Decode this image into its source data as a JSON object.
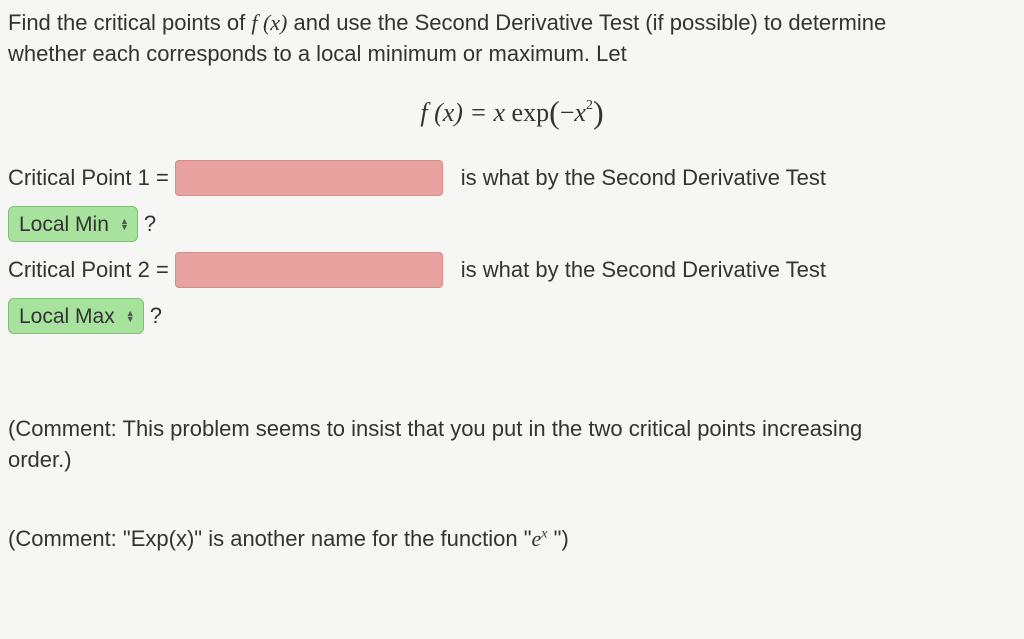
{
  "prompt": {
    "line1_pre": "Find the critical points of ",
    "line1_fx": "f (x)",
    "line1_post": " and use the Second Derivative Test (if possible) to determine",
    "line2": "whether each corresponds to a local minimum or maximum. Let"
  },
  "formula": {
    "lhs": "f (x) = x ",
    "exp_text": "exp",
    "lparen": "(",
    "arg_minus": "−",
    "arg_x": "x",
    "arg_exp": "2",
    "rparen": ")"
  },
  "cp1": {
    "label": "Critical Point 1 = ",
    "trail": "is what by the Second Derivative Test",
    "select": "Local Min",
    "qmark": "?"
  },
  "cp2": {
    "label": "Critical Point 2 = ",
    "trail": "is what by the Second Derivative Test",
    "select": "Local Max",
    "qmark": "?"
  },
  "comment1": {
    "pre": "(Comment: This problem seems to insist that you put in the two critical points increasing",
    "post": "order.)"
  },
  "comment2": {
    "pre": "(Comment: \"Exp(x)\" is another name for the function \"",
    "e": "e",
    "ex": "x",
    "post": " \")"
  }
}
